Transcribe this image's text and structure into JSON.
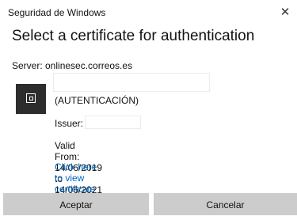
{
  "window": {
    "title": "Seguridad de Windows",
    "close_glyph": "✕"
  },
  "dialog": {
    "heading": "Select a certificate for authentication",
    "server_line": "Server: onlinesec.correos.es"
  },
  "certificate": {
    "icon": "certificate-icon",
    "subtitle": "(AUTENTICACIÓN)",
    "issuer_label": "Issuer:",
    "validity": "Valid From: 14/06/2019 to 14/06/2021",
    "properties_link": "Click here to view certificate properties"
  },
  "buttons": {
    "accept": "Aceptar",
    "cancel": "Cancelar"
  },
  "colors": {
    "link": "#0067c0",
    "button_bg": "#cccccc",
    "icon_bg": "#2d2d2d"
  }
}
